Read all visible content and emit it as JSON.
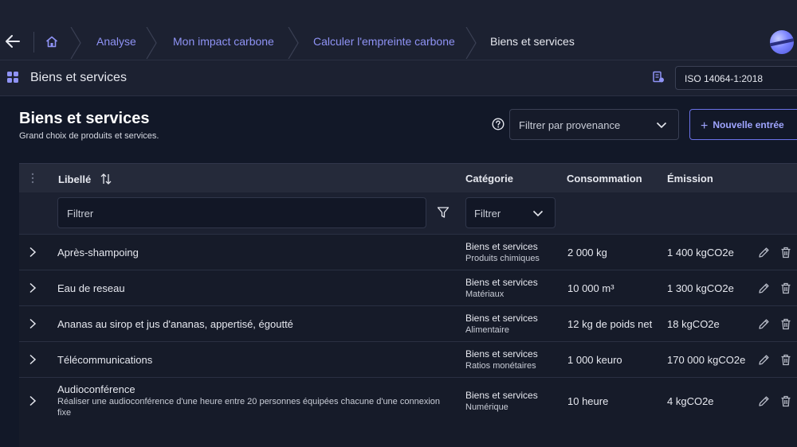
{
  "breadcrumb": {
    "items": [
      {
        "label": "Analyse"
      },
      {
        "label": "Mon impact carbone"
      },
      {
        "label": "Calculer l'empreinte carbone"
      },
      {
        "label": "Biens et services"
      }
    ]
  },
  "subheader": {
    "title": "Biens et services",
    "norm_value": "ISO 14064-1:2018"
  },
  "page": {
    "title": "Biens et services",
    "subtitle": "Grand choix de produits et services.",
    "origin_filter_placeholder": "Filtrer par provenance",
    "new_button_label": "Nouvelle entrée"
  },
  "table": {
    "columns": {
      "label": "Libellé",
      "category": "Catégorie",
      "consumption": "Consommation",
      "emission": "Émission"
    },
    "filters": {
      "label_placeholder": "Filtrer",
      "category_placeholder": "Filtrer"
    },
    "rows": [
      {
        "label": "Après-shampoing",
        "description": "",
        "category": "Biens et services",
        "subcategory": "Produits chimiques",
        "consumption": "2 000 kg",
        "emission": "1 400 kgCO2e"
      },
      {
        "label": "Eau de reseau",
        "description": "",
        "category": "Biens et services",
        "subcategory": "Matériaux",
        "consumption": "10 000 m³",
        "emission": "1 300 kgCO2e"
      },
      {
        "label": "Ananas au sirop et jus d'ananas, appertisé, égoutté",
        "description": "",
        "category": "Biens et services",
        "subcategory": "Alimentaire",
        "consumption": "12 kg de poids net",
        "emission": "18 kgCO2e"
      },
      {
        "label": "Télécommunications",
        "description": "",
        "category": "Biens et services",
        "subcategory": "Ratios monétaires",
        "consumption": "1 000 keuro",
        "emission": "170 000 kgCO2e"
      },
      {
        "label": "Audioconférence",
        "description": "Réaliser une audioconférence d'une heure entre 20 personnes équipées chacune d'une connexion fixe",
        "category": "Biens et services",
        "subcategory": "Numérique",
        "consumption": "10 heure",
        "emission": "4 kgCO2e"
      }
    ]
  },
  "colors": {
    "accent": "#8f93f5",
    "background": "#121828",
    "header": "#1c2131"
  }
}
